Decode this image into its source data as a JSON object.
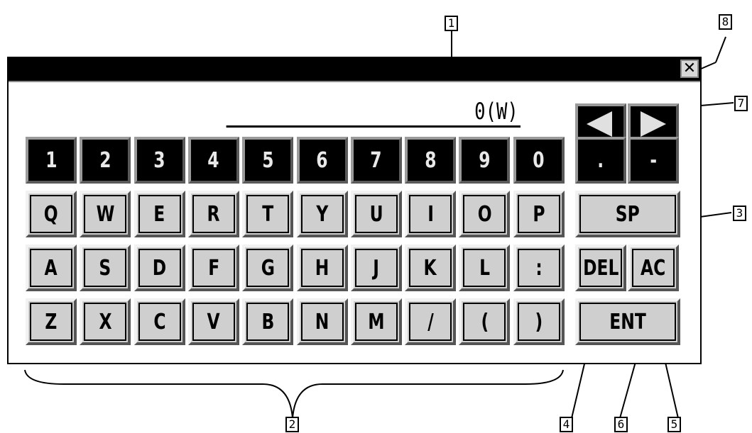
{
  "display": {
    "text": "0(W)"
  },
  "titlebar": {
    "close_glyph": "✕"
  },
  "keys": {
    "number_row": [
      "1",
      "2",
      "3",
      "4",
      "5",
      "6",
      "7",
      "8",
      "9",
      "0"
    ],
    "dot": ".",
    "minus": "-",
    "row_q": [
      "Q",
      "W",
      "E",
      "R",
      "T",
      "Y",
      "U",
      "I",
      "O",
      "P"
    ],
    "space": "SP",
    "row_a": [
      "A",
      "S",
      "D",
      "F",
      "G",
      "H",
      "J",
      "K",
      "L",
      ":"
    ],
    "del": "DEL",
    "ac": "AC",
    "row_z": [
      "Z",
      "X",
      "C",
      "V",
      "B",
      "N",
      "M",
      "/",
      "(",
      ")"
    ],
    "ent": "ENT"
  },
  "arrows": {
    "left_icon": "arrow-left-icon",
    "right_icon": "arrow-right-icon"
  },
  "callouts": [
    "1",
    "2",
    "3",
    "4",
    "5",
    "6",
    "7",
    "8"
  ],
  "colors": {
    "dark_key": "#000000",
    "light_key": "#cfcfcf",
    "titlebar": "#000000"
  }
}
